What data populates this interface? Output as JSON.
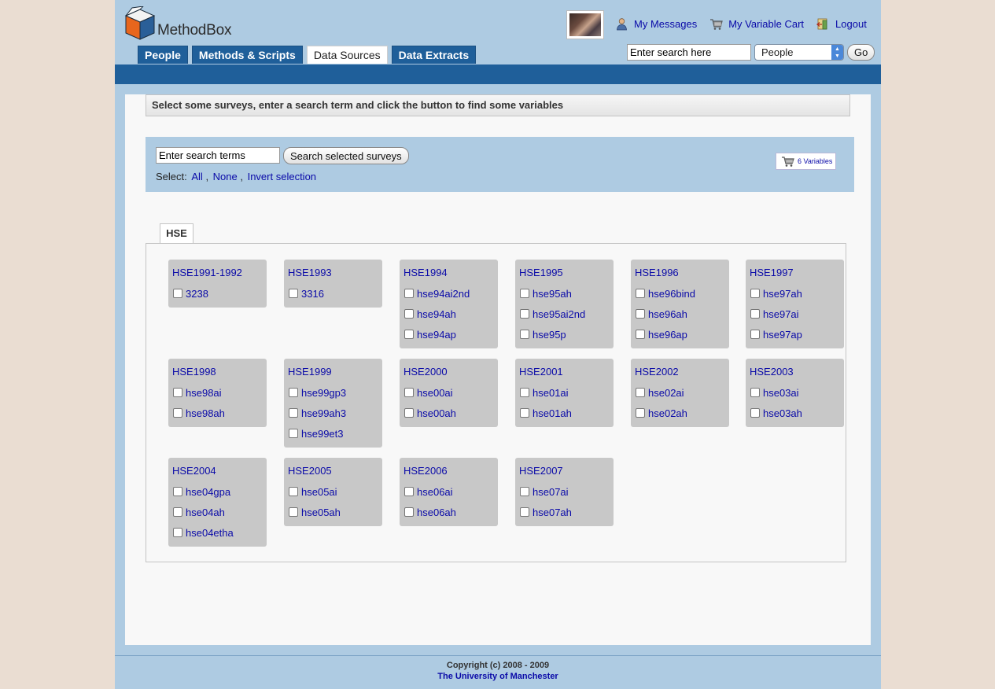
{
  "app": {
    "name": "MethodBox"
  },
  "nav": {
    "tabs": [
      {
        "label": "People",
        "active": false
      },
      {
        "label": "Methods & Scripts",
        "active": false
      },
      {
        "label": "Data Sources",
        "active": true
      },
      {
        "label": "Data Extracts",
        "active": false
      }
    ]
  },
  "toplinks": {
    "messages": "My Messages",
    "cart": "My Variable Cart",
    "logout": "Logout"
  },
  "search_top": {
    "placeholder": "Enter search here",
    "scope": "People",
    "go": "Go"
  },
  "instruction": "Select some surveys, enter a search term and click the button to find some variables",
  "search": {
    "placeholder": "Enter search terms",
    "button": "Search selected surveys",
    "select_label": "Select:",
    "all": "All",
    "none": "None",
    "invert": "Invert selection",
    "cart_count": "6 Variables"
  },
  "group": {
    "label": "HSE"
  },
  "surveys": [
    {
      "title": "HSE1991-1992",
      "items": [
        "3238"
      ]
    },
    {
      "title": "HSE1993",
      "items": [
        "3316"
      ]
    },
    {
      "title": "HSE1994",
      "items": [
        "hse94ai2nd",
        "hse94ah",
        "hse94ap"
      ]
    },
    {
      "title": "HSE1995",
      "items": [
        "hse95ah",
        "hse95ai2nd",
        "hse95p"
      ]
    },
    {
      "title": "HSE1996",
      "items": [
        "hse96bind",
        "hse96ah",
        "hse96ap"
      ]
    },
    {
      "title": "HSE1997",
      "items": [
        "hse97ah",
        "hse97ai",
        "hse97ap"
      ]
    },
    {
      "title": "HSE1998",
      "items": [
        "hse98ai",
        "hse98ah"
      ]
    },
    {
      "title": "HSE1999",
      "items": [
        "hse99gp3",
        "hse99ah3",
        "hse99et3"
      ]
    },
    {
      "title": "HSE2000",
      "items": [
        "hse00ai",
        "hse00ah"
      ]
    },
    {
      "title": "HSE2001",
      "items": [
        "hse01ai",
        "hse01ah"
      ]
    },
    {
      "title": "HSE2002",
      "items": [
        "hse02ai",
        "hse02ah"
      ]
    },
    {
      "title": "HSE2003",
      "items": [
        "hse03ai",
        "hse03ah"
      ]
    },
    {
      "title": "HSE2004",
      "items": [
        "hse04gpa",
        "hse04ah",
        "hse04etha"
      ]
    },
    {
      "title": "HSE2005",
      "items": [
        "hse05ai",
        "hse05ah"
      ]
    },
    {
      "title": "HSE2006",
      "items": [
        "hse06ai",
        "hse06ah"
      ]
    },
    {
      "title": "HSE2007",
      "items": [
        "hse07ai",
        "hse07ah"
      ]
    }
  ],
  "footer": {
    "copyright": "Copyright (c) 2008 - 2009",
    "org": "The University of Manchester"
  }
}
